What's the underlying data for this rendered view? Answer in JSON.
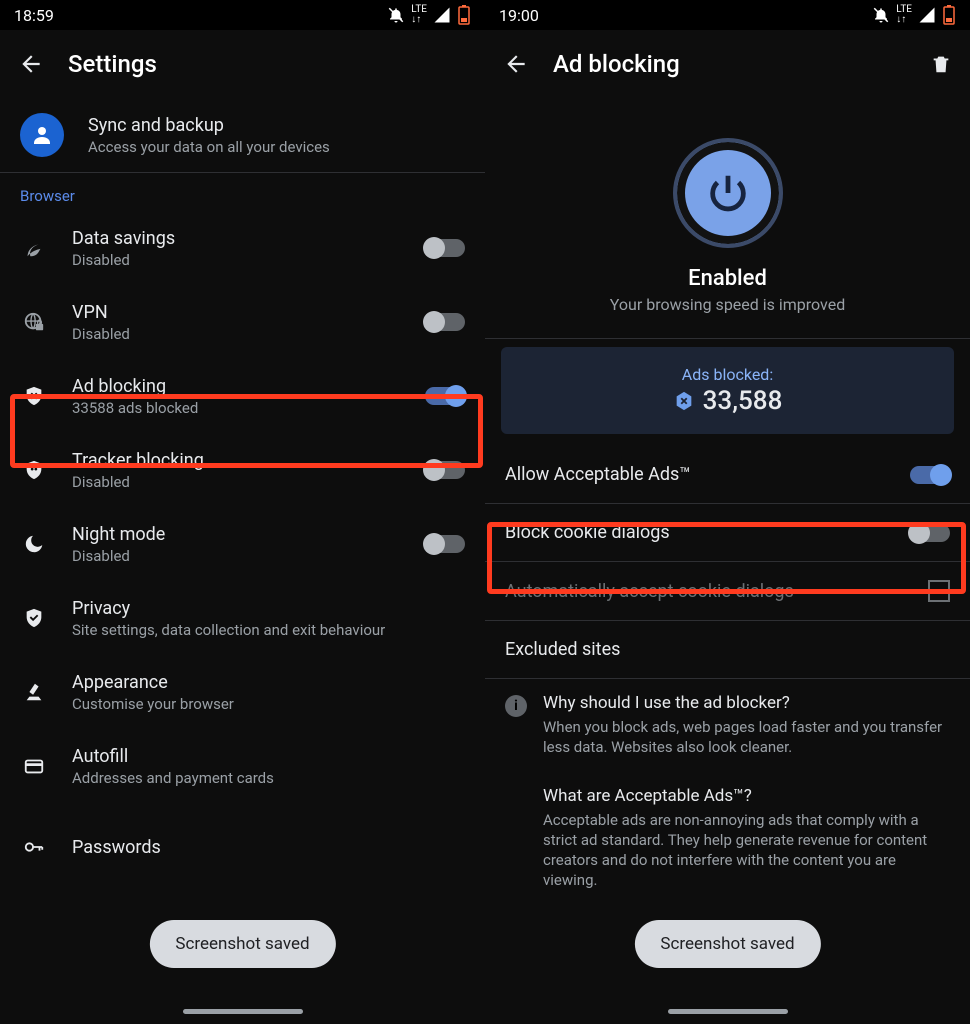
{
  "left": {
    "statusbar": {
      "time": "18:59"
    },
    "header": {
      "title": "Settings"
    },
    "sync": {
      "title": "Sync and backup",
      "sub": "Access your data on all your devices"
    },
    "section": "Browser",
    "items": [
      {
        "title": "Data savings",
        "sub": "Disabled",
        "on": false
      },
      {
        "title": "VPN",
        "sub": "Disabled",
        "on": false
      },
      {
        "title": "Ad blocking",
        "sub": "33588 ads blocked",
        "on": true
      },
      {
        "title": "Tracker blocking",
        "sub": "Disabled",
        "on": false
      },
      {
        "title": "Night mode",
        "sub": "Disabled",
        "on": false
      },
      {
        "title": "Privacy",
        "sub": "Site settings, data collection and exit behaviour"
      },
      {
        "title": "Appearance",
        "sub": "Customise your browser"
      },
      {
        "title": "Autofill",
        "sub": "Addresses and payment cards"
      },
      {
        "title": "Passwords",
        "sub": ""
      }
    ],
    "toast": "Screenshot saved"
  },
  "right": {
    "statusbar": {
      "time": "19:00"
    },
    "header": {
      "title": "Ad blocking"
    },
    "enabled": "Enabled",
    "enabled_sub": "Your browsing speed is improved",
    "stat_label": "Ads blocked:",
    "stat_value": "33,588",
    "allow_aa": "Allow Acceptable Ads™",
    "block_cookie": "Block cookie dialogs",
    "auto_accept": "Automatically accept cookie dialogs",
    "excluded": "Excluded sites",
    "faq1_title": "Why should I use the ad blocker?",
    "faq1_body": "When you block ads, web pages load faster and you transfer less data. Websites also look cleaner.",
    "faq2_title": "What are Acceptable Ads™?",
    "faq2_body": "Acceptable ads are non-annoying ads that comply with a strict ad standard. They help generate revenue for content creators and do not interfere with the content you are viewing.",
    "toast": "Screenshot saved"
  }
}
